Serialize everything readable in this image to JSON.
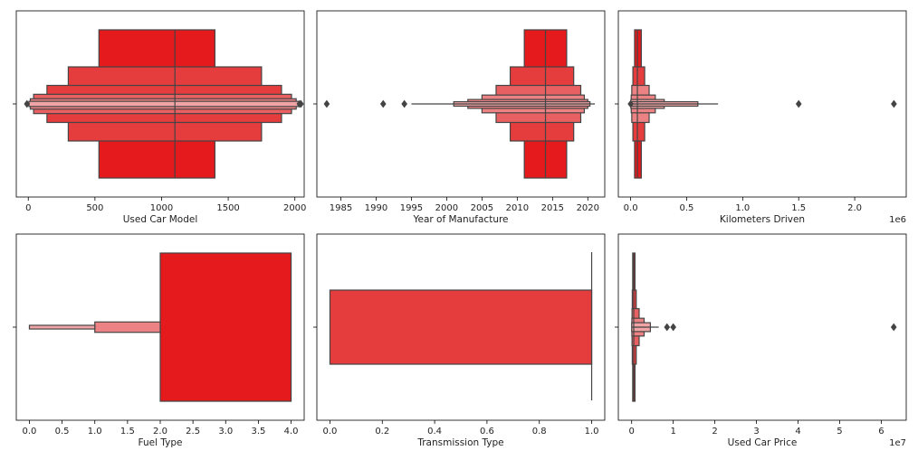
{
  "chart_data": [
    {
      "type": "boxen",
      "xlabel": "Used Car Model",
      "xlim": [
        -90,
        2070
      ],
      "xticks": [
        0,
        500,
        1000,
        1500,
        2000
      ],
      "tick_labels": [
        "0",
        "500",
        "1000",
        "1500",
        "2000"
      ],
      "offset_text": "",
      "boxes": [
        {
          "lo": 530,
          "hi": 1400,
          "height": 1.0,
          "color": "#e41a1c"
        },
        {
          "lo": 300,
          "hi": 1750,
          "height": 0.5,
          "color": "#e53d3e"
        },
        {
          "lo": 140,
          "hi": 1900,
          "height": 0.25,
          "color": "#e53d3e"
        },
        {
          "lo": 40,
          "hi": 1975,
          "height": 0.13,
          "color": "#e86061"
        },
        {
          "lo": 15,
          "hi": 2010,
          "height": 0.07,
          "color": "#ec8283"
        },
        {
          "lo": 5,
          "hi": 2025,
          "height": 0.035,
          "color": "#f0a4a5"
        }
      ],
      "median": 1100,
      "whisker": null,
      "outliers": [
        -10,
        2035,
        2045
      ]
    },
    {
      "type": "boxen",
      "xlabel": "Year of Manufacture",
      "xlim": [
        1981.6,
        2022.4
      ],
      "xticks": [
        1985,
        1990,
        1995,
        2000,
        2005,
        2010,
        2015,
        2020
      ],
      "tick_labels": [
        "1985",
        "1990",
        "1995",
        "2000",
        "2005",
        "2010",
        "2015",
        "2020"
      ],
      "offset_text": "",
      "boxes": [
        {
          "lo": 2011,
          "hi": 2017,
          "height": 1.0,
          "color": "#e41a1c"
        },
        {
          "lo": 2009,
          "hi": 2018,
          "height": 0.5,
          "color": "#e53d3e"
        },
        {
          "lo": 2007,
          "hi": 2019,
          "height": 0.25,
          "color": "#e86061"
        },
        {
          "lo": 2005,
          "hi": 2019.5,
          "height": 0.12,
          "color": "#ec8283"
        },
        {
          "lo": 2003,
          "hi": 2020,
          "height": 0.06,
          "color": "#ec8283"
        },
        {
          "lo": 2001,
          "hi": 2020.3,
          "height": 0.03,
          "color": "#f0a4a5"
        }
      ],
      "median": 2014,
      "whisker": [
        1995,
        2021
      ],
      "outliers": [
        1983,
        1991,
        1994
      ]
    },
    {
      "type": "boxen",
      "xlabel": "Kilometers Driven",
      "xlim": [
        -110000,
        2460000
      ],
      "xticks": [
        0,
        500000,
        1000000,
        1500000,
        2000000
      ],
      "tick_labels": [
        "0.0",
        "0.5",
        "1.0",
        "1.5",
        "2.0"
      ],
      "offset_text": "1e6",
      "boxes": [
        {
          "lo": 35000,
          "hi": 95000,
          "height": 1.0,
          "color": "#e41a1c"
        },
        {
          "lo": 20000,
          "hi": 125000,
          "height": 0.5,
          "color": "#e53d3e"
        },
        {
          "lo": 10000,
          "hi": 165000,
          "height": 0.25,
          "color": "#ec8283"
        },
        {
          "lo": 5000,
          "hi": 220000,
          "height": 0.12,
          "color": "#ec8283"
        },
        {
          "lo": 2000,
          "hi": 300000,
          "height": 0.06,
          "color": "#f0a4a5"
        },
        {
          "lo": 1000,
          "hi": 600000,
          "height": 0.03,
          "color": "#f0a4a5"
        }
      ],
      "median": 60000,
      "whisker": [
        0,
        780000
      ],
      "outliers": [
        0,
        1500000,
        2350000
      ]
    },
    {
      "type": "boxen",
      "xlabel": "Fuel Type",
      "xlim": [
        -0.2,
        4.2
      ],
      "xticks": [
        0,
        0.5,
        1,
        1.5,
        2,
        2.5,
        3,
        3.5,
        4
      ],
      "tick_labels": [
        "0.0",
        "0.5",
        "1.0",
        "1.5",
        "2.0",
        "2.5",
        "3.0",
        "3.5",
        "4.0"
      ],
      "offset_text": "",
      "boxes": [
        {
          "lo": 2.0,
          "hi": 4.0,
          "height": 1.0,
          "color": "#e41a1c"
        },
        {
          "lo": 1.0,
          "hi": 2.0,
          "height": 0.07,
          "color": "#ec8283"
        },
        {
          "lo": 0.0,
          "hi": 1.0,
          "height": 0.025,
          "color": "#f0a4a5"
        }
      ],
      "median": null,
      "whisker": null,
      "outliers": []
    },
    {
      "type": "boxen",
      "xlabel": "Transmission Type",
      "xlim": [
        -0.05,
        1.05
      ],
      "xticks": [
        0,
        0.2,
        0.4,
        0.6,
        0.8,
        1.0
      ],
      "tick_labels": [
        "0.0",
        "0.2",
        "0.4",
        "0.6",
        "0.8",
        "1.0"
      ],
      "offset_text": "",
      "boxes": [
        {
          "lo": 0.0,
          "hi": 1.0,
          "height": 0.5,
          "color": "#e53d3e"
        }
      ],
      "median": null,
      "whisker": [
        1.0,
        1.0
      ],
      "whisker_vertical": true,
      "outliers": []
    },
    {
      "type": "boxen",
      "xlabel": "Used Car Price",
      "xlim": [
        -3200000,
        66000000
      ],
      "xticks": [
        0,
        10000000,
        20000000,
        30000000,
        40000000,
        50000000,
        60000000
      ],
      "tick_labels": [
        "0",
        "1",
        "2",
        "3",
        "4",
        "5",
        "6"
      ],
      "offset_text": "1e7",
      "boxes": [
        {
          "lo": 250000,
          "hi": 800000,
          "height": 1.0,
          "color": "#e41a1c"
        },
        {
          "lo": 150000,
          "hi": 1100000,
          "height": 0.5,
          "color": "#e53d3e"
        },
        {
          "lo": 100000,
          "hi": 1800000,
          "height": 0.25,
          "color": "#e86061"
        },
        {
          "lo": 50000,
          "hi": 3000000,
          "height": 0.12,
          "color": "#ec8283"
        },
        {
          "lo": 20000,
          "hi": 4500000,
          "height": 0.06,
          "color": "#f0a4a5"
        }
      ],
      "median": 500000,
      "whisker": [
        0,
        6500000
      ],
      "outliers": [
        8500000,
        10000000,
        63000000
      ]
    }
  ]
}
